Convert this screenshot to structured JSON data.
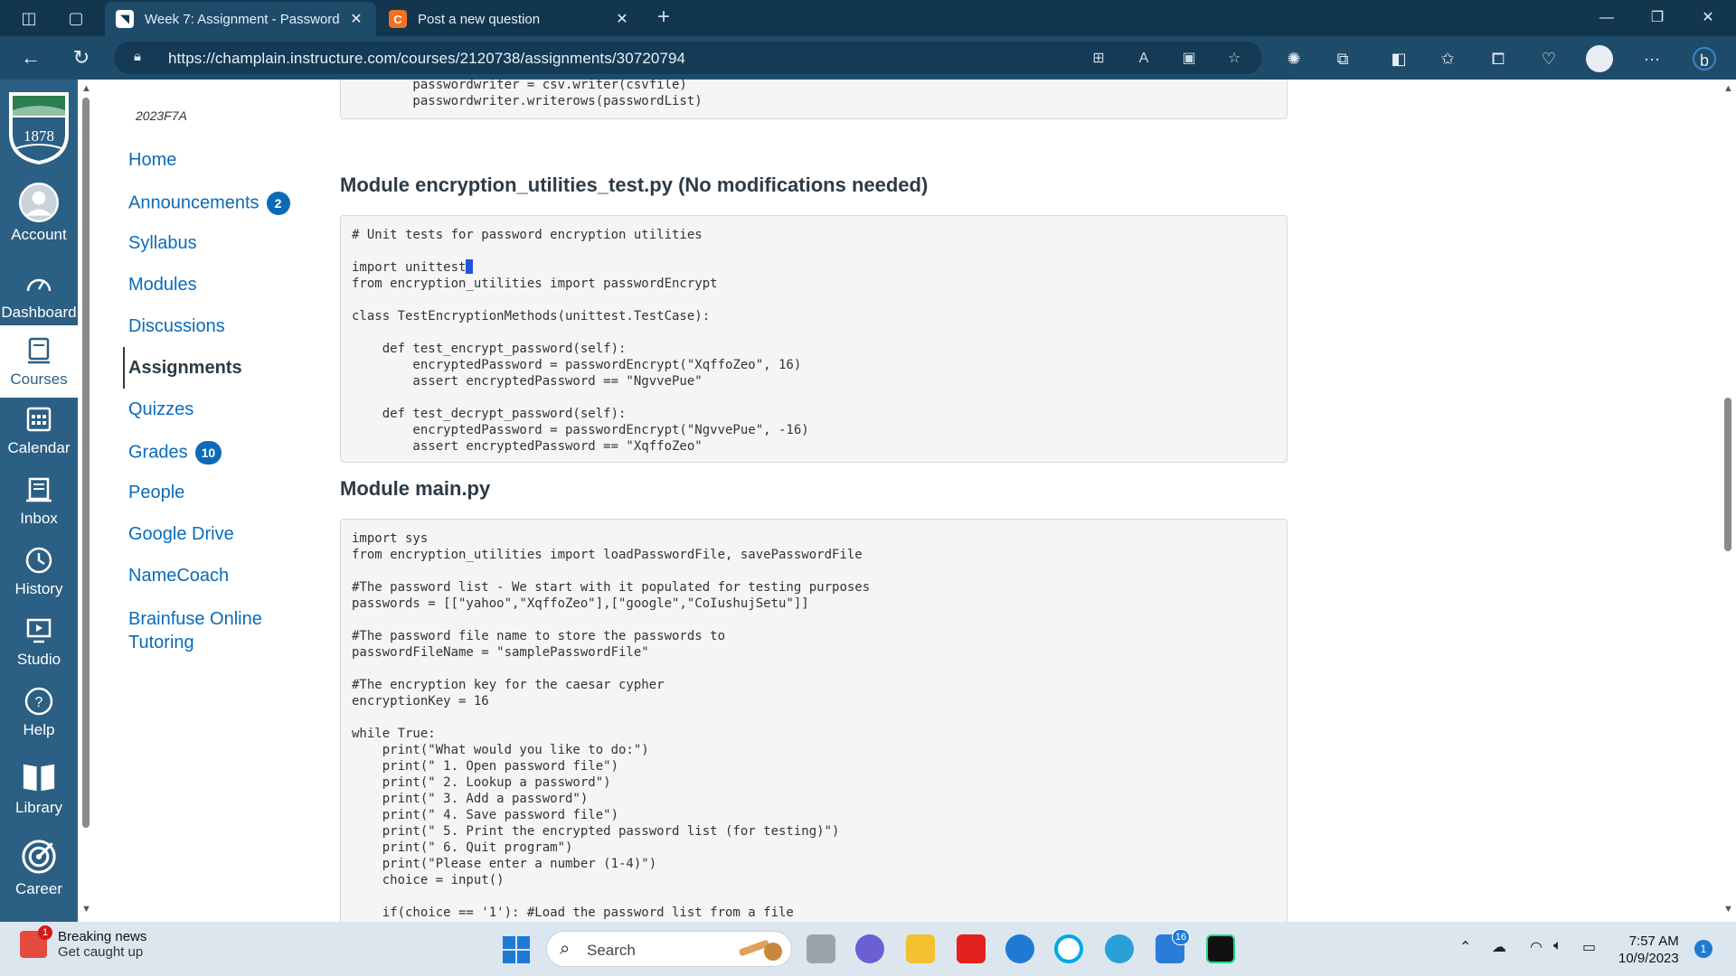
{
  "browser": {
    "tabs": [
      {
        "title": "Week 7: Assignment - Password",
        "active": true
      },
      {
        "title": "Post a new question",
        "active": false
      }
    ],
    "url": "https://champlain.instructure.com/courses/2120738/assignments/30720794"
  },
  "global_nav": [
    {
      "label": "Account",
      "icon": "account-icon"
    },
    {
      "label": "Dashboard",
      "icon": "dashboard-icon"
    },
    {
      "label": "Courses",
      "icon": "courses-icon",
      "active": true
    },
    {
      "label": "Calendar",
      "icon": "calendar-icon"
    },
    {
      "label": "Inbox",
      "icon": "inbox-icon"
    },
    {
      "label": "History",
      "icon": "history-icon"
    },
    {
      "label": "Studio",
      "icon": "studio-icon"
    },
    {
      "label": "Help",
      "icon": "help-icon"
    },
    {
      "label": "Library",
      "icon": "library-icon"
    },
    {
      "label": "Career",
      "icon": "career-icon"
    }
  ],
  "logo_text": "1878",
  "course_nav": {
    "code": "2023F7A",
    "items": [
      {
        "label": "Home"
      },
      {
        "label": "Announcements",
        "badge": "2"
      },
      {
        "label": "Syllabus"
      },
      {
        "label": "Modules"
      },
      {
        "label": "Discussions"
      },
      {
        "label": "Assignments",
        "active": true
      },
      {
        "label": "Quizzes"
      },
      {
        "label": "Grades",
        "badge": "10"
      },
      {
        "label": "People"
      },
      {
        "label": "Google Drive"
      },
      {
        "label": "NameCoach"
      },
      {
        "label": "Brainfuse Online Tutoring"
      }
    ]
  },
  "content": {
    "top_code": "        passwordwriter = csv.writer(csvfile)\n        passwordwriter.writerows(passwordList)",
    "heading_test": "Module encryption_utilities_test.py (No modifications needed)",
    "test_code_a": "# Unit tests for password encryption utilities\n\nimport unittest",
    "test_code_b": "from encryption_utilities import passwordEncrypt\n\nclass TestEncryptionMethods(unittest.TestCase):\n\n    def test_encrypt_password(self):\n        encryptedPassword = passwordEncrypt(\"XqffoZeo\", 16)\n        assert encryptedPassword == \"NgvvePue\"\n\n    def test_decrypt_password(self):\n        encryptedPassword = passwordEncrypt(\"NgvvePue\", -16)\n        assert encryptedPassword == \"XqffoZeo\"",
    "heading_main": "Module main.py",
    "main_code": "import sys\nfrom encryption_utilities import loadPasswordFile, savePasswordFile\n\n#The password list - We start with it populated for testing purposes\npasswords = [[\"yahoo\",\"XqffoZeo\"],[\"google\",\"CoIushujSetu\"]]\n\n#The password file name to store the passwords to\npasswordFileName = \"samplePasswordFile\"\n\n#The encryption key for the caesar cypher\nencryptionKey = 16\n\nwhile True:\n    print(\"What would you like to do:\")\n    print(\" 1. Open password file\")\n    print(\" 2. Lookup a password\")\n    print(\" 3. Add a password\")\n    print(\" 4. Save password file\")\n    print(\" 5. Print the encrypted password list (for testing)\")\n    print(\" 6. Quit program\")\n    print(\"Please enter a number (1-4)\")\n    choice = input()\n\n    if(choice == '1'): #Load the password list from a file"
  },
  "taskbar": {
    "news_title": "Breaking news",
    "news_sub": "Get caught up",
    "news_count": "1",
    "search_label": "Search",
    "app_badge": "16",
    "time": "7:57 AM",
    "date": "10/9/2023",
    "notif_count": "1"
  },
  "colors": {
    "canvas_nav": "#2b5f83",
    "link": "#0b6bb8",
    "browser_bar": "#1f4b6b"
  }
}
